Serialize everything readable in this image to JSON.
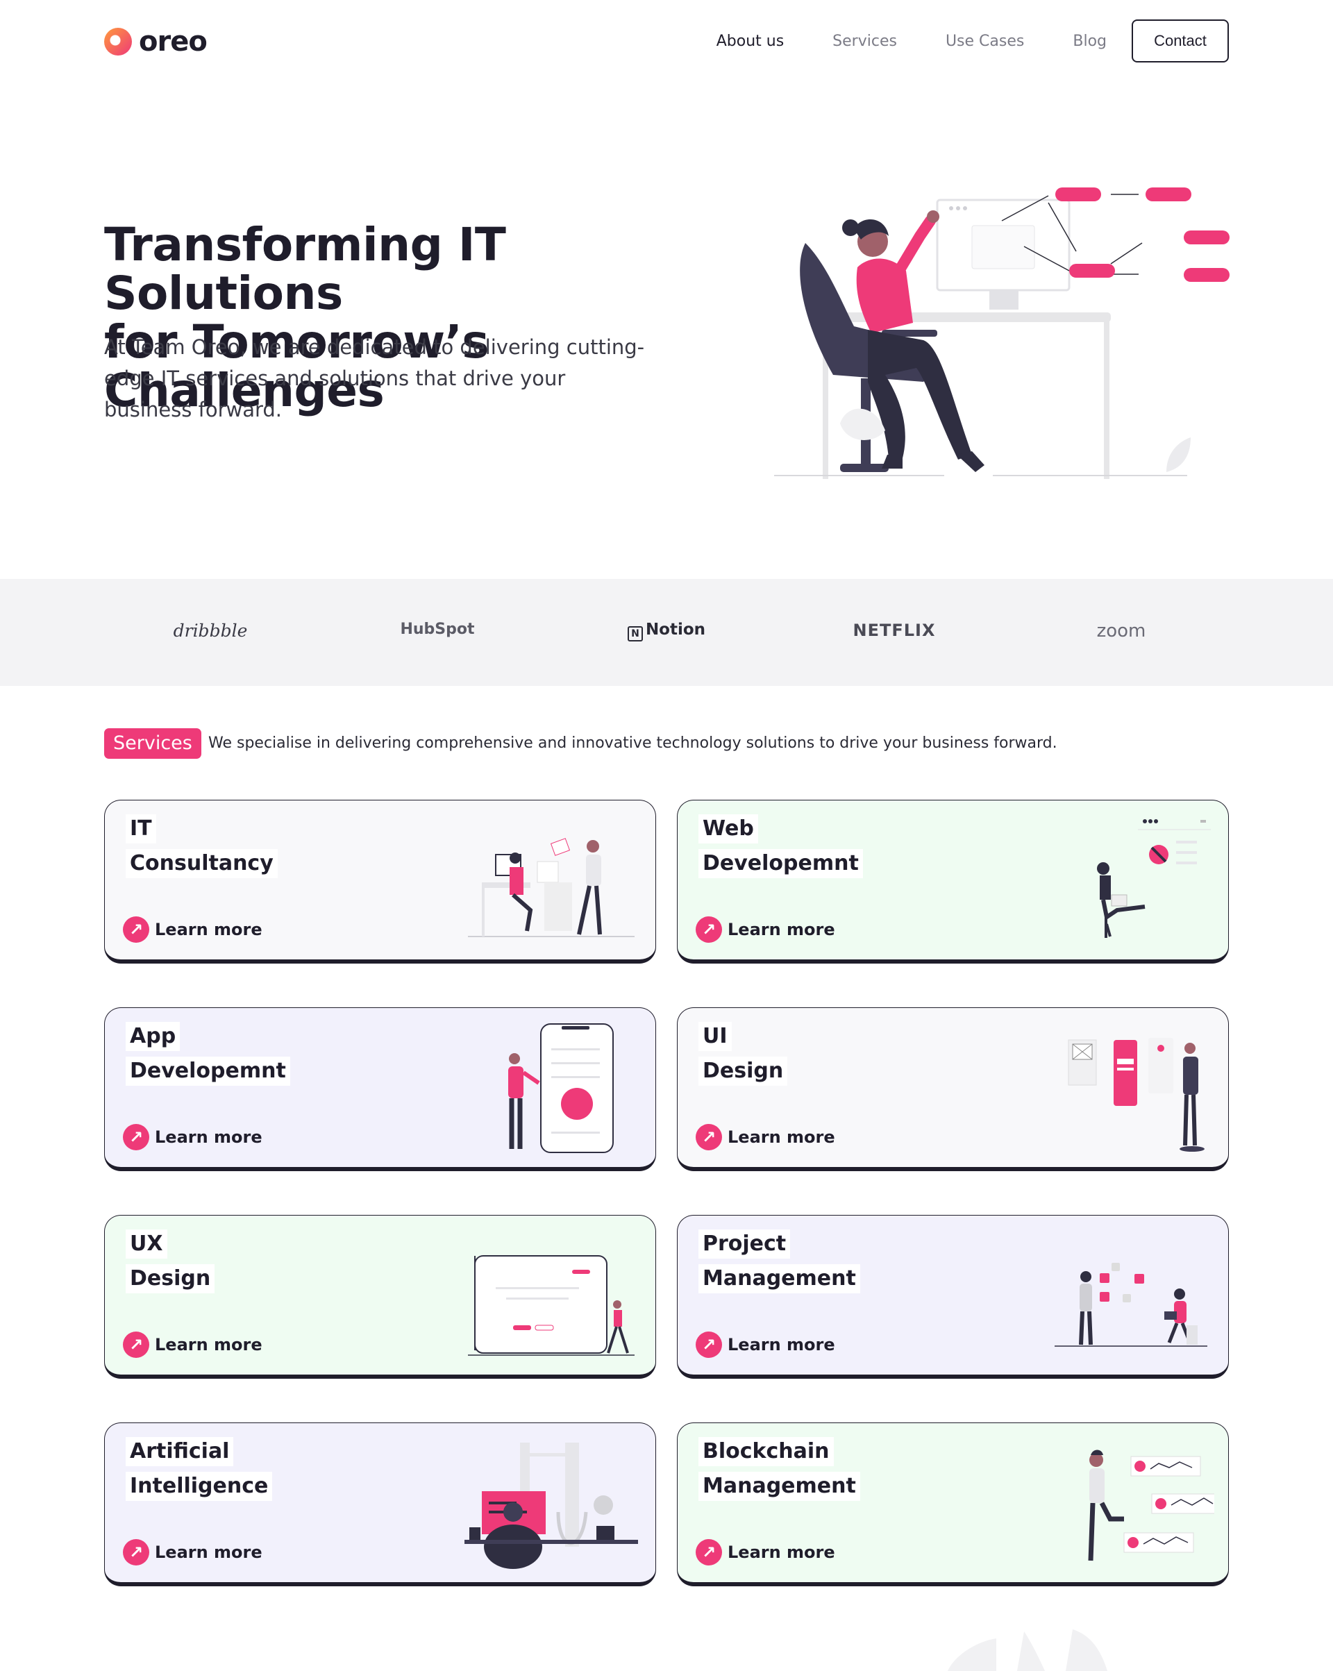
{
  "brand": {
    "name": "oreo"
  },
  "nav": {
    "links": [
      {
        "label": "About us"
      },
      {
        "label": "Services"
      },
      {
        "label": "Use Cases"
      },
      {
        "label": "Blog"
      }
    ],
    "contact_label": "Contact"
  },
  "hero": {
    "title_line1": "Transforming IT Solutions",
    "title_line2": "for Tomorrow’s Challenges",
    "subtitle": "At Team Oreo, we are dedicated to delivering cutting-edge IT services and solutions that drive your business forward."
  },
  "brands": [
    "dribbble",
    "HubSpot",
    "Notion",
    "NETFLIX",
    "zoom"
  ],
  "services": {
    "badge": "Services",
    "intro": "We specialise in delivering comprehensive and innovative technology solutions to drive your business forward.",
    "learn_more": "Learn more",
    "cards": [
      {
        "line1": "IT",
        "line2": "Consultancy"
      },
      {
        "line1": "Web",
        "line2": "Developemnt"
      },
      {
        "line1": "App",
        "line2": "Developemnt"
      },
      {
        "line1": "UI",
        "line2": "Design"
      },
      {
        "line1": "UX",
        "line2": "Design"
      },
      {
        "line1": "Project",
        "line2": "Management"
      },
      {
        "line1": "Artificial",
        "line2": "Intelligence"
      },
      {
        "line1": "Blockchain",
        "line2": "Management"
      }
    ]
  },
  "colors": {
    "accent": "#ee3a78",
    "dark": "#1f1d2b",
    "strip": "#f3f3f5"
  }
}
